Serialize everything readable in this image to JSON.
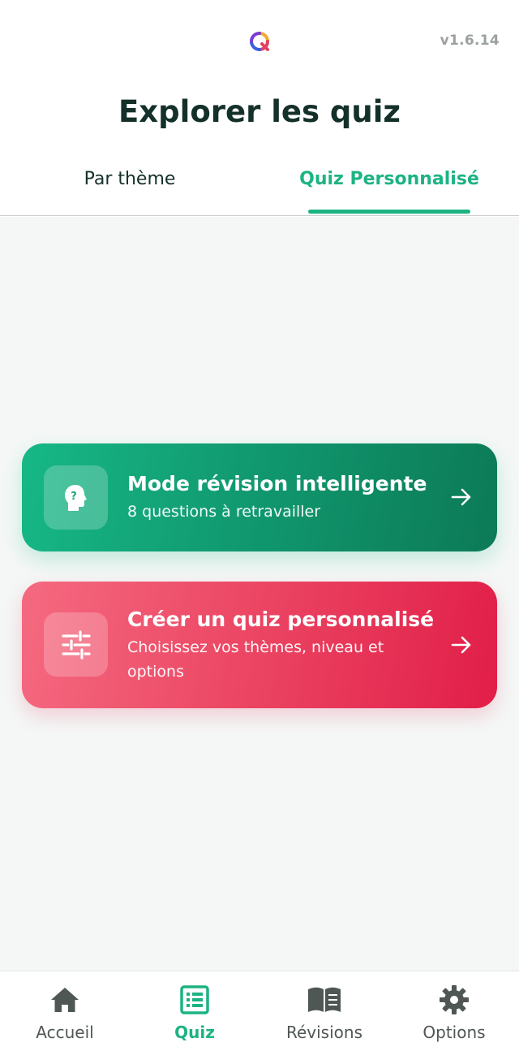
{
  "header": {
    "logo": "quiz-logo",
    "version": "v1.6.14",
    "title": "Explorer les quiz"
  },
  "tabs": [
    {
      "label": "Par thème",
      "active": false
    },
    {
      "label": "Quiz Personnalisé",
      "active": true
    }
  ],
  "cards": {
    "revision": {
      "icon": "head-question-icon",
      "title": "Mode révision intelligente",
      "subtitle": "8 questions à retravailler",
      "arrow": "arrow-right-icon",
      "color_start": "#17b886",
      "color_end": "#0c7a56"
    },
    "custom": {
      "icon": "sliders-icon",
      "title": "Créer un quiz personnalisé",
      "subtitle": "Choisissez vos thèmes, niveau et options",
      "arrow": "arrow-right-icon",
      "color_start": "#f56a80",
      "color_end": "#e11e48"
    }
  },
  "bottom_nav": [
    {
      "label": "Accueil",
      "icon": "home-icon",
      "active": false
    },
    {
      "label": "Quiz",
      "icon": "list-icon",
      "active": true
    },
    {
      "label": "Révisions",
      "icon": "book-icon",
      "active": false
    },
    {
      "label": "Options",
      "icon": "gear-icon",
      "active": false
    }
  ],
  "colors": {
    "accent": "#1db383",
    "title_text": "#14302a",
    "inactive_nav": "#4f5754",
    "background": "#f4f7f6"
  }
}
